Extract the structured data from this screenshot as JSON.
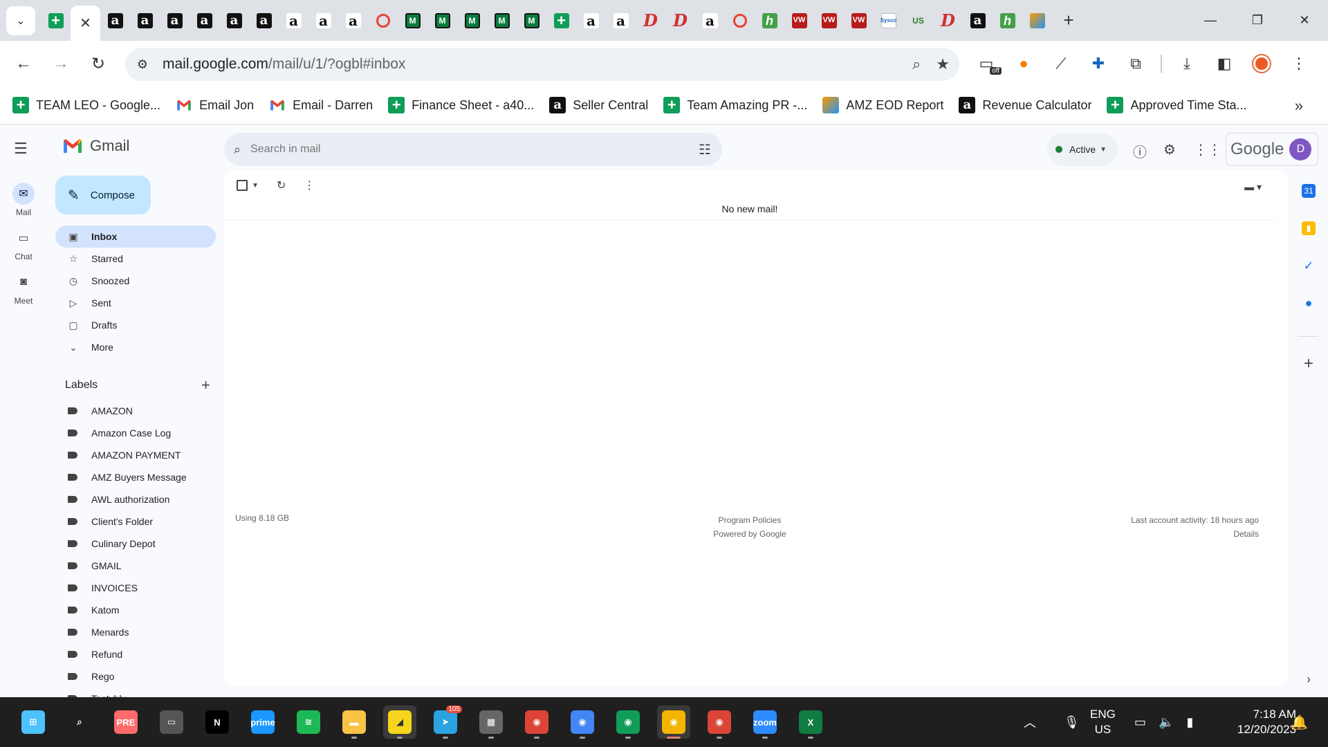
{
  "browser": {
    "tab_favicons": [
      "sheet",
      "sheet",
      "amz",
      "amz",
      "amz",
      "amz",
      "amz",
      "amz",
      "amzw",
      "amzw",
      "amzw",
      "google",
      "menards",
      "menards",
      "menards",
      "menards",
      "menards",
      "sheet",
      "amzw",
      "amzw",
      "pinterest",
      "pinterest",
      "amzw",
      "google",
      "hw",
      "vw",
      "vw",
      "vw",
      "sysco",
      "usfoods",
      "pinterest",
      "amz",
      "hw",
      "eod"
    ],
    "active_tab_index": 1,
    "url_host": "mail.google.com",
    "url_path": "/mail/u/1/?ogbl#inbox",
    "extension_badge": "off",
    "bookmarks": [
      {
        "label": "TEAM LEO - Google...",
        "icon": "sheet"
      },
      {
        "label": "Email Jon",
        "icon": "gmail"
      },
      {
        "label": "Email - Darren",
        "icon": "gmail"
      },
      {
        "label": "Finance Sheet - a40...",
        "icon": "sheet"
      },
      {
        "label": "Seller Central",
        "icon": "amz"
      },
      {
        "label": "Team Amazing PR -...",
        "icon": "sheet"
      },
      {
        "label": "AMZ EOD Report",
        "icon": "eod"
      },
      {
        "label": "Revenue Calculator",
        "icon": "amz"
      },
      {
        "label": "Approved Time Sta...",
        "icon": "sheet"
      }
    ]
  },
  "gmail": {
    "brand": "Gmail",
    "rail": [
      {
        "label": "Mail",
        "icon": "mail-icon",
        "active": true
      },
      {
        "label": "Chat",
        "icon": "chat-icon",
        "active": false
      },
      {
        "label": "Meet",
        "icon": "video-icon",
        "active": false
      }
    ],
    "compose_label": "Compose",
    "nav": [
      {
        "label": "Inbox",
        "icon": "inbox-icon",
        "glyph": "▣",
        "active": true
      },
      {
        "label": "Starred",
        "icon": "star-icon",
        "glyph": "☆",
        "active": false
      },
      {
        "label": "Snoozed",
        "icon": "clock-icon",
        "glyph": "◷",
        "active": false
      },
      {
        "label": "Sent",
        "icon": "send-icon",
        "glyph": "▷",
        "active": false
      },
      {
        "label": "Drafts",
        "icon": "draft-icon",
        "glyph": "▢",
        "active": false
      },
      {
        "label": "More",
        "icon": "chevron-down-icon",
        "glyph": "⌄",
        "active": false
      }
    ],
    "labels_title": "Labels",
    "labels": [
      "AMAZON",
      "Amazon Case Log",
      "AMAZON PAYMENT",
      "AMZ Buyers Message",
      "AWL authorization",
      "Client's Folder",
      "Culinary Depot",
      "GMAIL",
      "INVOICES",
      "Katom",
      "Menards",
      "Refund",
      "Rego",
      "Tastyblu"
    ],
    "search_placeholder": "Search in mail",
    "status": "Active",
    "account_brand": "Google",
    "avatar_initial": "D",
    "empty_message": "No new mail!",
    "storage": "Using 8.18 GB",
    "footer_policies": "Program Policies",
    "footer_powered": "Powered by Google",
    "last_activity": "Last account activity: 18 hours ago",
    "details_link": "Details"
  },
  "taskbar": {
    "lang_line1": "ENG",
    "lang_line2": "US",
    "time": "7:18 AM",
    "date": "12/20/2023",
    "telegram_badge": "105",
    "apps": [
      {
        "name": "start-button",
        "color": "#4cc2ff",
        "glyph": "⊞"
      },
      {
        "name": "search-taskbar",
        "color": "transparent",
        "glyph": "⌕"
      },
      {
        "name": "copilot-app",
        "color": "#ff6b6b",
        "glyph": "PRE"
      },
      {
        "name": "task-view-app",
        "color": "#555",
        "glyph": "▭"
      },
      {
        "name": "netflix-app",
        "color": "#000",
        "glyph": "N"
      },
      {
        "name": "prime-video-app",
        "color": "#1a98ff",
        "glyph": "prime"
      },
      {
        "name": "spotify-app",
        "color": "#1db954",
        "glyph": "≋"
      },
      {
        "name": "file-explorer-app",
        "color": "#f8c445",
        "glyph": "▬"
      },
      {
        "name": "sticky-notes-app",
        "color": "#f7d51d",
        "glyph": "◢"
      },
      {
        "name": "telegram-app",
        "color": "#2aa3e0",
        "glyph": "➤"
      },
      {
        "name": "calculator-app",
        "color": "#666",
        "glyph": "▦"
      },
      {
        "name": "chrome-profile-1",
        "color": "#db4437",
        "glyph": "◉"
      },
      {
        "name": "chrome-profile-2",
        "color": "#4285f4",
        "glyph": "◉"
      },
      {
        "name": "chrome-profile-3",
        "color": "#0f9d58",
        "glyph": "◉"
      },
      {
        "name": "chrome-profile-4",
        "color": "#f4b400",
        "glyph": "◉"
      },
      {
        "name": "chrome-profile-5",
        "color": "#db4437",
        "glyph": "◉"
      },
      {
        "name": "zoom-app",
        "color": "#2d8cff",
        "glyph": "zoom"
      },
      {
        "name": "excel-app",
        "color": "#107c41",
        "glyph": "X"
      }
    ]
  },
  "colors": {
    "accent": "#c2e7ff",
    "active_nav": "#d3e3fd",
    "status_green": "#188038"
  }
}
